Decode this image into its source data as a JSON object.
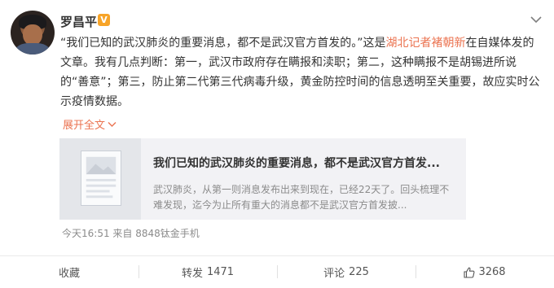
{
  "post": {
    "username": "罗昌平",
    "badge_icon": "vip-verified-icon",
    "badge_color": "#f7a428",
    "text_part1": "“我们已知的武汉肺炎的重要消息，都不是武汉官方首发的。”这是",
    "mention": "湖北记者褚朝新",
    "text_part2": "在自媒体发的文章。我有几点判断：第一，武汉市政府存在瞒报和渎职；第二，这种瞒报不是胡锡进所说的“善意”；第三，防止第二代第三代病毒升级，黄金防控时间的信息透明至关重要，故应实时公示疫情数据。",
    "expand_label": "展开全文",
    "accent_color": "#eb7350"
  },
  "card": {
    "title": "我们已知的武汉肺炎的重要消息，都不是武汉官方首发...",
    "summary": "武汉肺炎，从第一则消息发布出来到现在，已经22天了。回头梳理不难发现，迄今为止所有重大的消息都不是武汉官方首发披..."
  },
  "meta": {
    "time": "今天16:51",
    "source": "来自 8848钛金手机"
  },
  "actions": {
    "favorite_label": "收藏",
    "repost_label": "转发",
    "repost_count": "1471",
    "comment_label": "评论",
    "comment_count": "225",
    "like_count": "3268"
  }
}
